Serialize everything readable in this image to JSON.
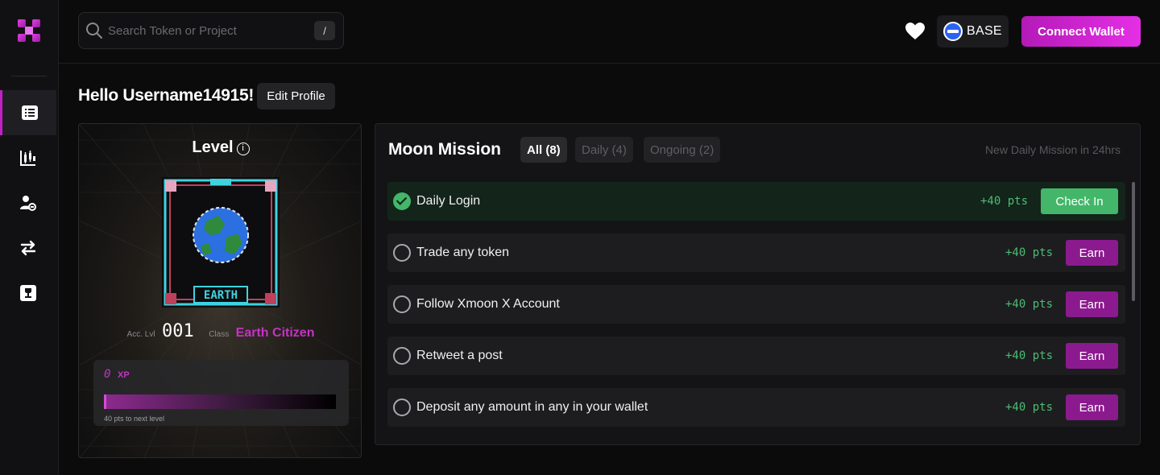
{
  "topbar": {
    "search_placeholder": "Search Token or Project",
    "search_shortcut": "/",
    "chain_label": "BASE",
    "connect_label": "Connect Wallet"
  },
  "greeting": {
    "text": "Hello Username14915!",
    "edit_label": "Edit Profile"
  },
  "level_card": {
    "title": "Level",
    "info_glyph": "i",
    "badge_text": "EARTH",
    "acc_label": "Acc. Lvl",
    "acc_value": "001",
    "class_label": "Class",
    "class_value": "Earth Citizen",
    "xp_value": "0",
    "xp_unit": "XP",
    "xp_progress": 0,
    "next_level_text": "40 pts to next level"
  },
  "missions": {
    "title": "Moon Mission",
    "tabs": [
      {
        "label": "All (8)"
      },
      {
        "label": "Daily (4)"
      },
      {
        "label": "Ongoing (2)"
      }
    ],
    "new_daily_text": "New Daily Mission in 24hrs",
    "items": [
      {
        "label": "Daily Login",
        "pts": "+40 pts",
        "action": "Check In",
        "done": true
      },
      {
        "label": "Trade any token",
        "pts": "+40 pts",
        "action": "Earn",
        "done": false
      },
      {
        "label": "Follow Xmoon X Account",
        "pts": "+40 pts",
        "action": "Earn",
        "done": false
      },
      {
        "label": "Retweet a post",
        "pts": "+40 pts",
        "action": "Earn",
        "done": false
      },
      {
        "label": "Deposit any amount in any in your wallet",
        "pts": "+40 pts",
        "action": "Earn",
        "done": false
      }
    ]
  },
  "colors": {
    "accent": "#c21fc6",
    "success": "#43b66a",
    "earn_button": "#8c1a8f",
    "background": "#0b0b0c"
  },
  "icons": {
    "logo": "x-logo-icon",
    "nav": [
      "list-icon",
      "candlestick-chart-icon",
      "user-link-icon",
      "swap-arrows-icon",
      "trophy-icon"
    ],
    "search": "search-icon",
    "favorites": "heart-icon",
    "chain": "base-chain-icon"
  }
}
